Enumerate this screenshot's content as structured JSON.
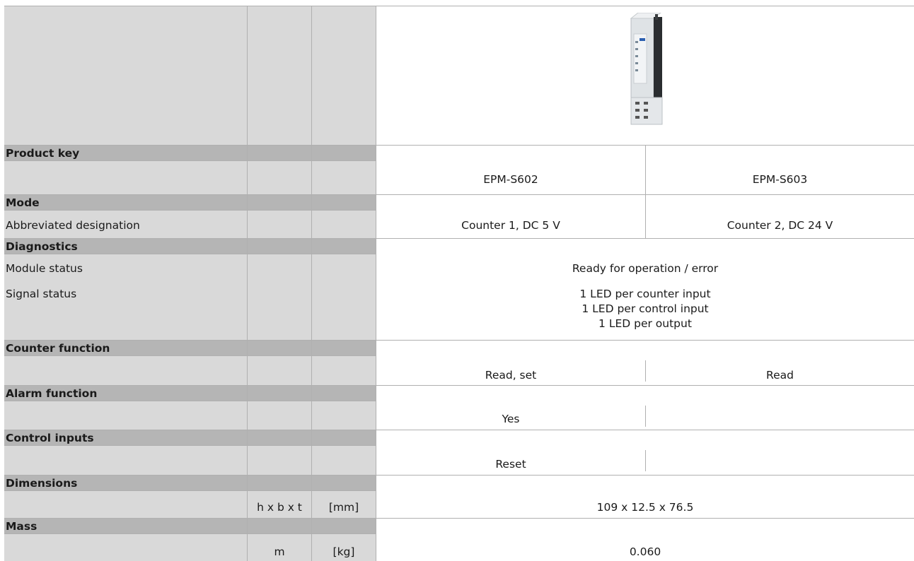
{
  "table": {
    "sections": {
      "product_key": "Product key",
      "mode": "Mode",
      "diagnostics": "Diagnostics",
      "counter_function": "Counter function",
      "alarm_function": "Alarm function",
      "control_inputs": "Control inputs",
      "dimensions": "Dimensions",
      "mass": "Mass"
    },
    "products": [
      "EPM-S602",
      "EPM-S603"
    ],
    "abbrev_label": "Abbreviated designation",
    "abbrev": [
      "Counter 1, DC 5 V",
      "Counter 2, DC 24 V"
    ],
    "module_status_label": "Module status",
    "module_status": "Ready for operation / error",
    "signal_status_label": "Signal status",
    "signal_status": [
      "1 LED per counter input",
      "1 LED per control input",
      "1 LED per output"
    ],
    "counter_function": [
      "Read, set",
      "Read"
    ],
    "alarm_function": [
      "Yes",
      ""
    ],
    "control_inputs": [
      "Reset",
      ""
    ],
    "dimensions": {
      "symbol": "h x b x t",
      "unit": "[mm]",
      "value": "109 x 12.5 x 76.5"
    },
    "mass": {
      "symbol": "m",
      "unit": "[kg]",
      "value": "0.060"
    }
  }
}
